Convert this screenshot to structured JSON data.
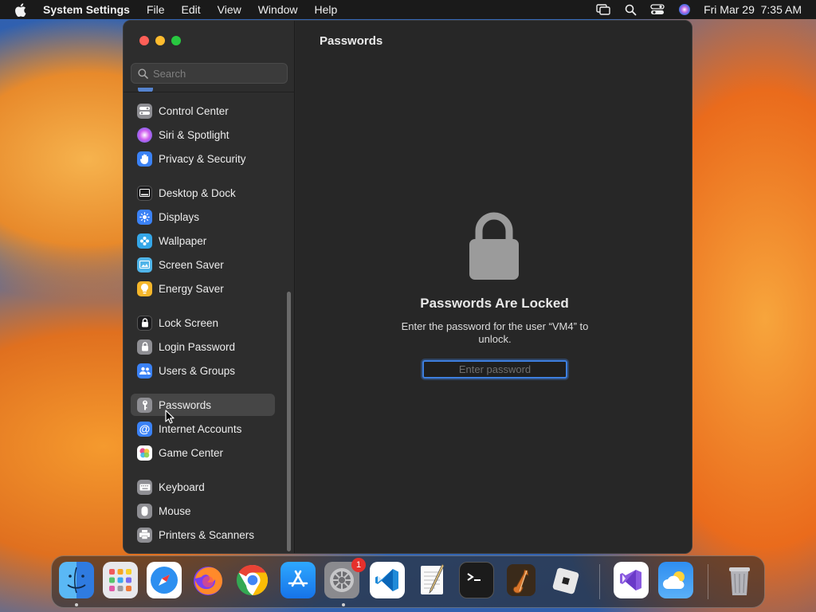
{
  "menubar": {
    "app_name": "System Settings",
    "menus": [
      "File",
      "Edit",
      "View",
      "Window",
      "Help"
    ],
    "datetime": "Fri Mar 29  7:35 AM"
  },
  "sidebar": {
    "search_placeholder": "Search",
    "items": [
      {
        "label": "Control Center",
        "icon": "control-center-icon",
        "color": "#8e8e93"
      },
      {
        "label": "Siri & Spotlight",
        "icon": "siri-icon",
        "color": "#b04fd6"
      },
      {
        "label": "Privacy & Security",
        "icon": "hand-icon",
        "color": "#3b82f6"
      },
      {
        "label": "Desktop & Dock",
        "icon": "dock-icon",
        "color": "#1c1c1e"
      },
      {
        "label": "Displays",
        "icon": "sun-icon",
        "color": "#3b82f6"
      },
      {
        "label": "Wallpaper",
        "icon": "flower-icon",
        "color": "#35a7e8"
      },
      {
        "label": "Screen Saver",
        "icon": "screen-saver-icon",
        "color": "#4fb4e8"
      },
      {
        "label": "Energy Saver",
        "icon": "bulb-icon",
        "color": "#f5b62a"
      },
      {
        "label": "Lock Screen",
        "icon": "lock-icon",
        "color": "#1c1c1e"
      },
      {
        "label": "Login Password",
        "icon": "lock-icon",
        "color": "#8e8e93"
      },
      {
        "label": "Users & Groups",
        "icon": "users-icon",
        "color": "#3b82f6"
      },
      {
        "label": "Passwords",
        "icon": "key-icon",
        "color": "#8e8e93"
      },
      {
        "label": "Internet Accounts",
        "icon": "at-icon",
        "color": "#3b82f6"
      },
      {
        "label": "Game Center",
        "icon": "game-center-icon",
        "color": "#e85a8c"
      },
      {
        "label": "Keyboard",
        "icon": "keyboard-icon",
        "color": "#8e8e93"
      },
      {
        "label": "Mouse",
        "icon": "mouse-icon",
        "color": "#8e8e93"
      },
      {
        "label": "Printers & Scanners",
        "icon": "printer-icon",
        "color": "#8e8e93"
      }
    ],
    "selected": "Passwords"
  },
  "content": {
    "title": "Passwords",
    "lock_title": "Passwords Are Locked",
    "lock_message": "Enter the password for the user “VM4” to unlock.",
    "password_placeholder": "Enter password"
  },
  "dock": {
    "apps": [
      "Finder",
      "Launchpad",
      "Safari",
      "Firefox",
      "Google Chrome",
      "App Store",
      "System Settings",
      "Visual Studio Code",
      "TextEdit",
      "Terminal",
      "GarageBand",
      "Roblox",
      "Visual Studio",
      "Weather",
      "Trash"
    ],
    "settings_badge": "1"
  },
  "colors": {
    "accent": "#3d7fe0",
    "traffic_red": "#ff5f57",
    "traffic_yellow": "#febc2e",
    "traffic_green": "#28c840"
  }
}
